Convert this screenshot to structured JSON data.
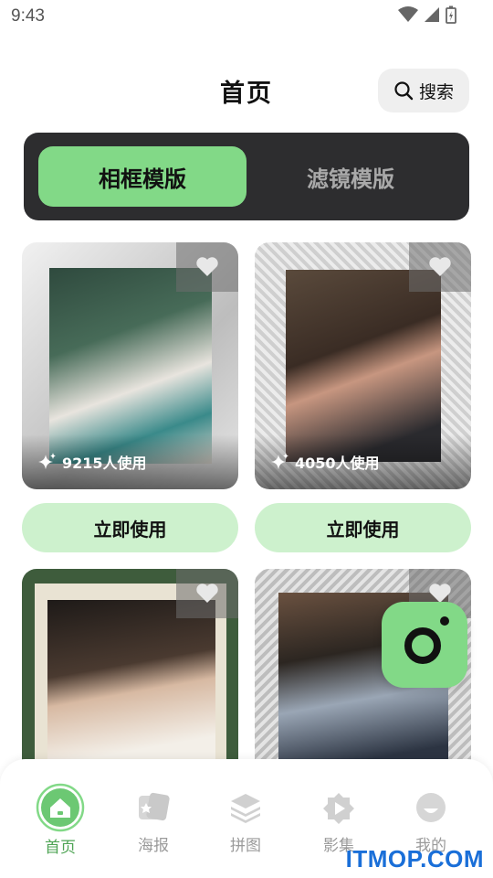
{
  "status": {
    "time": "9:43"
  },
  "header": {
    "title": "首页",
    "search_label": "搜索"
  },
  "tabs": [
    {
      "label": "相框模版",
      "active": true
    },
    {
      "label": "滤镜模版",
      "active": false
    }
  ],
  "cards": [
    {
      "usage": "9215人使用",
      "use_label": "立即使用"
    },
    {
      "usage": "4050人使用",
      "use_label": "立即使用"
    },
    {
      "usage": "",
      "use_label": ""
    },
    {
      "usage": "",
      "use_label": ""
    }
  ],
  "nav": [
    {
      "label": "首页",
      "icon": "home-icon",
      "active": true
    },
    {
      "label": "海报",
      "icon": "poster-icon",
      "active": false
    },
    {
      "label": "拼图",
      "icon": "layers-icon",
      "active": false
    },
    {
      "label": "影集",
      "icon": "album-play-icon",
      "active": false
    },
    {
      "label": "我的",
      "icon": "profile-icon",
      "active": false
    }
  ],
  "colors": {
    "accent": "#82d987",
    "accent_light": "#cdf1cd",
    "active_nav": "#4ea454",
    "dark_panel": "#2d2d2f"
  },
  "watermark": "ITMOP.COM"
}
